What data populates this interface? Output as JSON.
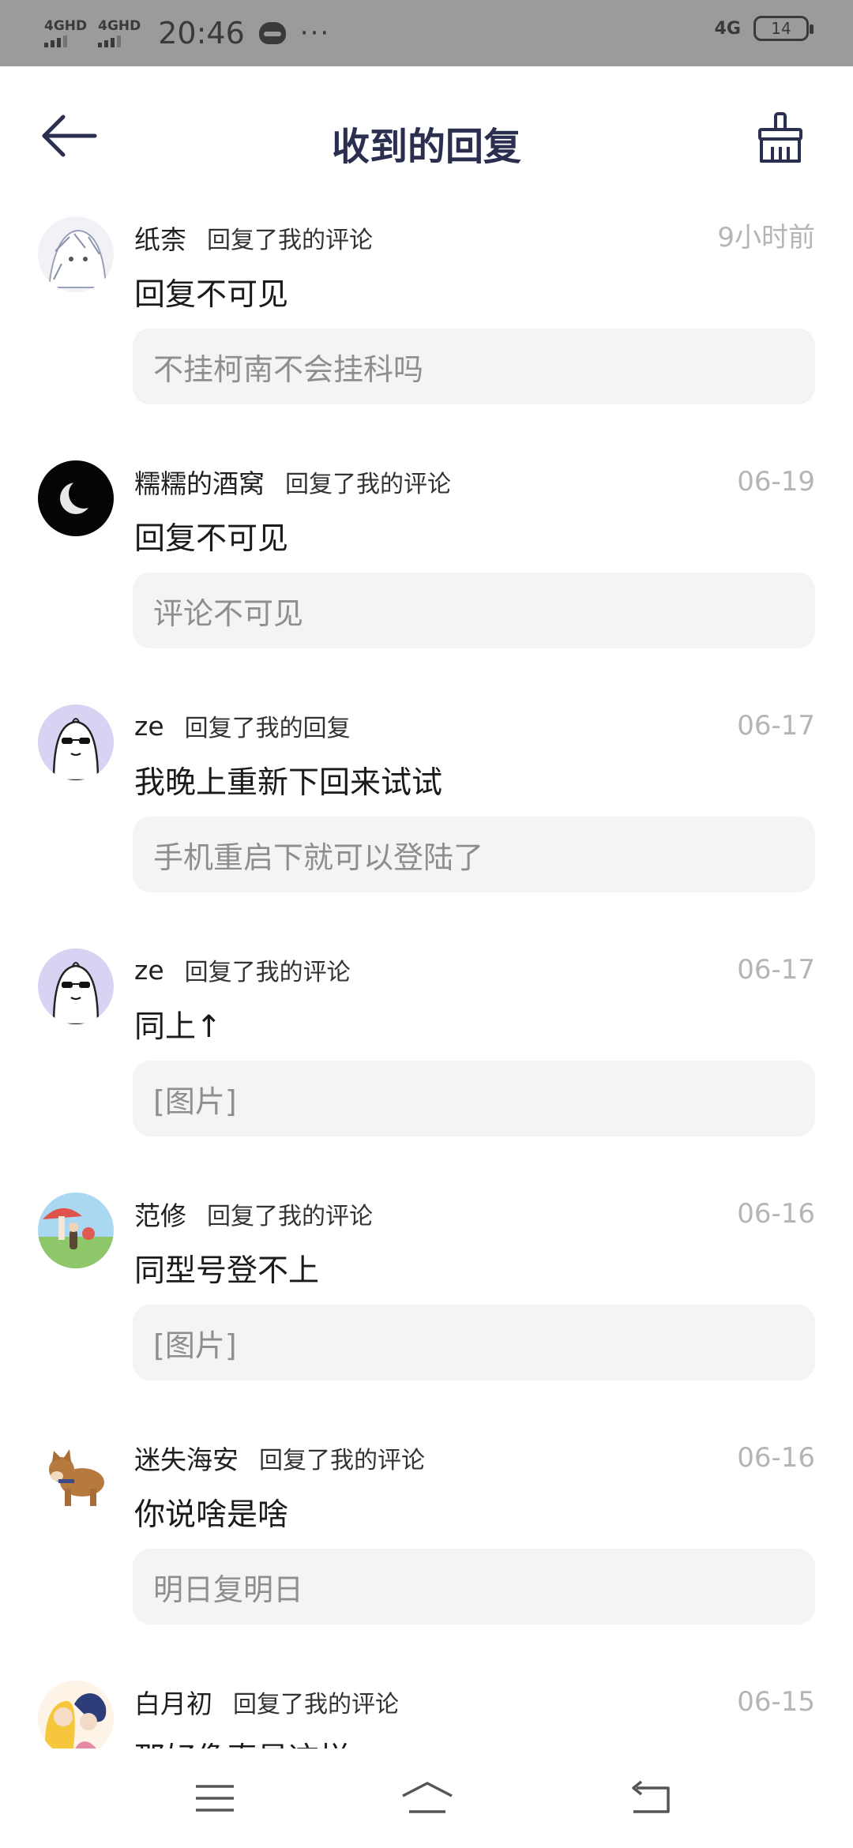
{
  "status_bar": {
    "sim1": "4GHD",
    "sim2": "4GHD",
    "time": "20:46",
    "dots": "···",
    "network": "4G",
    "battery": "14"
  },
  "header": {
    "title": "收到的回复",
    "back_icon": "arrow-left-icon",
    "clean_icon": "broom-icon"
  },
  "replies": [
    {
      "user": "纸柰",
      "action": "回复了我的评论",
      "time": "9小时前",
      "text": "回复不可见",
      "quote": "不挂柯南不会挂科吗",
      "avatar": "anime-sketch-avatar"
    },
    {
      "user": "糯糯的酒窝",
      "action": "回复了我的评论",
      "time": "06-19",
      "text": "回复不可见",
      "quote": "评论不可见",
      "avatar": "moon-avatar"
    },
    {
      "user": "ze",
      "action": "回复了我的回复",
      "time": "06-17",
      "text": "我晚上重新下回来试试",
      "quote": "手机重启下就可以登陆了",
      "avatar": "sunglasses-ghost-avatar"
    },
    {
      "user": "ze",
      "action": "回复了我的评论",
      "time": "06-17",
      "text": "同上↑",
      "quote": "[图片]",
      "avatar": "sunglasses-ghost-avatar"
    },
    {
      "user": "范修",
      "action": "回复了我的评论",
      "time": "06-16",
      "text": "同型号登不上",
      "quote": "[图片]",
      "avatar": "mushroom-scene-avatar"
    },
    {
      "user": "迷失海安",
      "action": "回复了我的评论",
      "time": "06-16",
      "text": "你说啥是啥",
      "quote": "明日复明日",
      "avatar": "shiba-dog-avatar"
    },
    {
      "user": "白月初",
      "action": "回复了我的评论",
      "time": "06-15",
      "text": "那好像真是这样",
      "quote": "",
      "avatar": "anime-couple-avatar"
    }
  ],
  "bottom_nav": {
    "menu_icon": "menu-icon",
    "home_icon": "home-icon",
    "back_icon": "return-icon"
  }
}
